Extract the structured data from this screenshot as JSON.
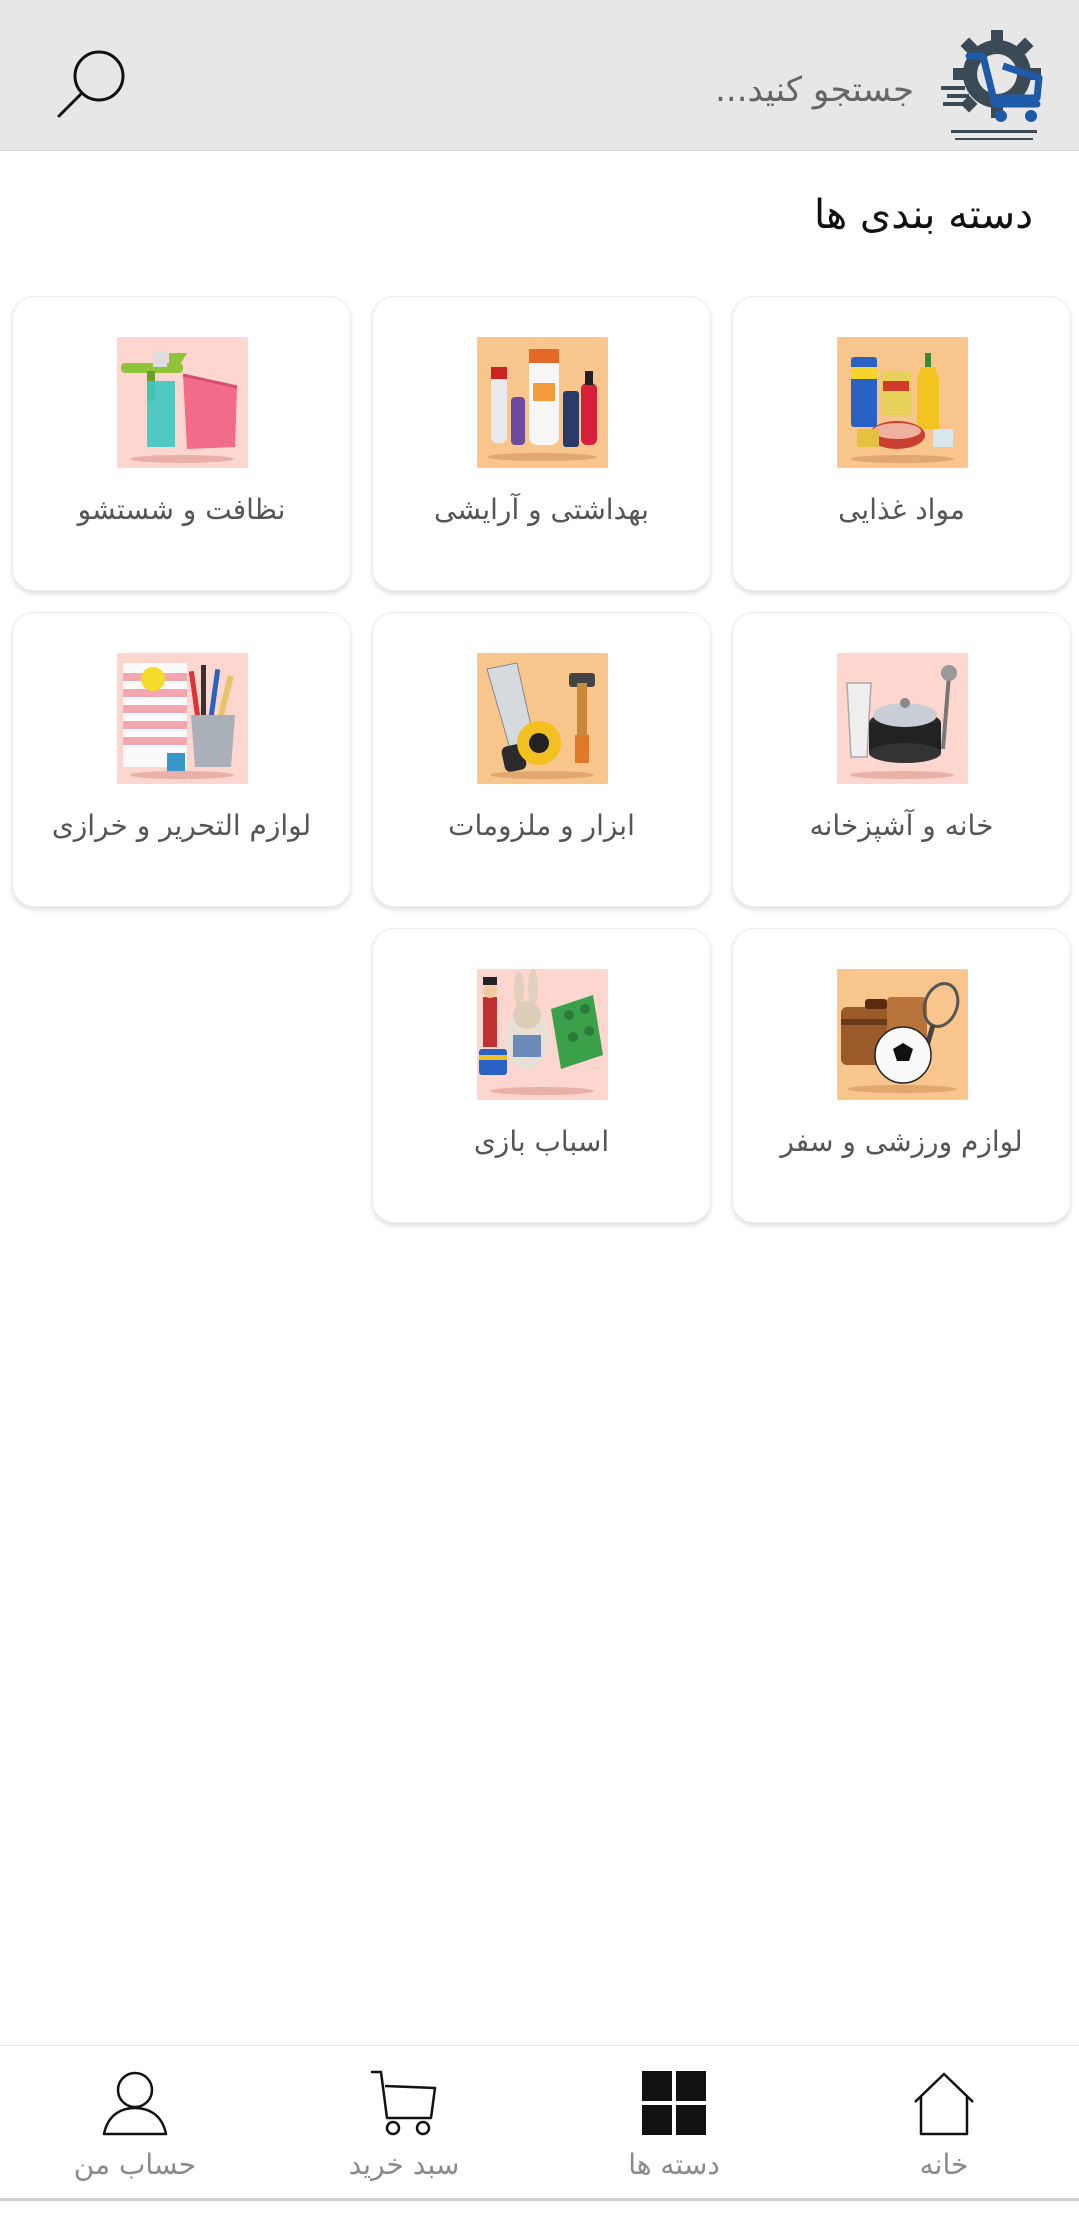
{
  "header": {
    "search_placeholder": "جستجو کنید...",
    "logo_icon": "store-logo-icon",
    "search_icon": "search-icon"
  },
  "main": {
    "title": "دسته بندی ها"
  },
  "categories": [
    {
      "label": "مواد غذایی",
      "icon": "groceries-image"
    },
    {
      "label": "بهداشتی و آرایشی",
      "icon": "cosmetics-image"
    },
    {
      "label": "نظافت و شستشو",
      "icon": "cleaning-image"
    },
    {
      "label": "خانه و آشپزخانه",
      "icon": "kitchen-image"
    },
    {
      "label": "ابزار و ملزومات",
      "icon": "tools-image"
    },
    {
      "label": "لوازم التحریر و خرازی",
      "icon": "stationery-image"
    },
    {
      "label": "لوازم ورزشی و سفر",
      "icon": "sports-travel-image"
    },
    {
      "label": "اسباب بازی",
      "icon": "toys-image"
    }
  ],
  "bottom_nav": {
    "home": "خانه",
    "categories": "دسته ها",
    "cart": "سبد خرید",
    "account": "حساب من"
  },
  "colors": {
    "header_bg": "#e7e7e7",
    "thumb_orange": "#f8c58c",
    "thumb_pink": "#fdd6cf",
    "nav_label": "#8a8a8a"
  }
}
